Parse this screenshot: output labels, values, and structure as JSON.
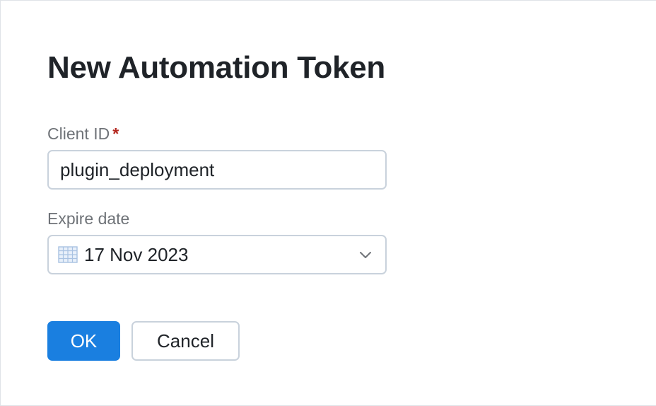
{
  "dialog": {
    "title": "New Automation Token"
  },
  "client_id": {
    "label": "Client ID",
    "required_marker": "*",
    "value": "plugin_deployment"
  },
  "expire_date": {
    "label": "Expire date",
    "value": "17 Nov 2023",
    "icon": "calendar-icon",
    "dropdown_icon": "chevron-down-icon"
  },
  "actions": {
    "ok_label": "OK",
    "cancel_label": "Cancel"
  },
  "colors": {
    "primary": "#1a7fe0",
    "required": "#b3261e",
    "border": "#c9d2dc",
    "label": "#6f7378",
    "text": "#1f2328"
  }
}
